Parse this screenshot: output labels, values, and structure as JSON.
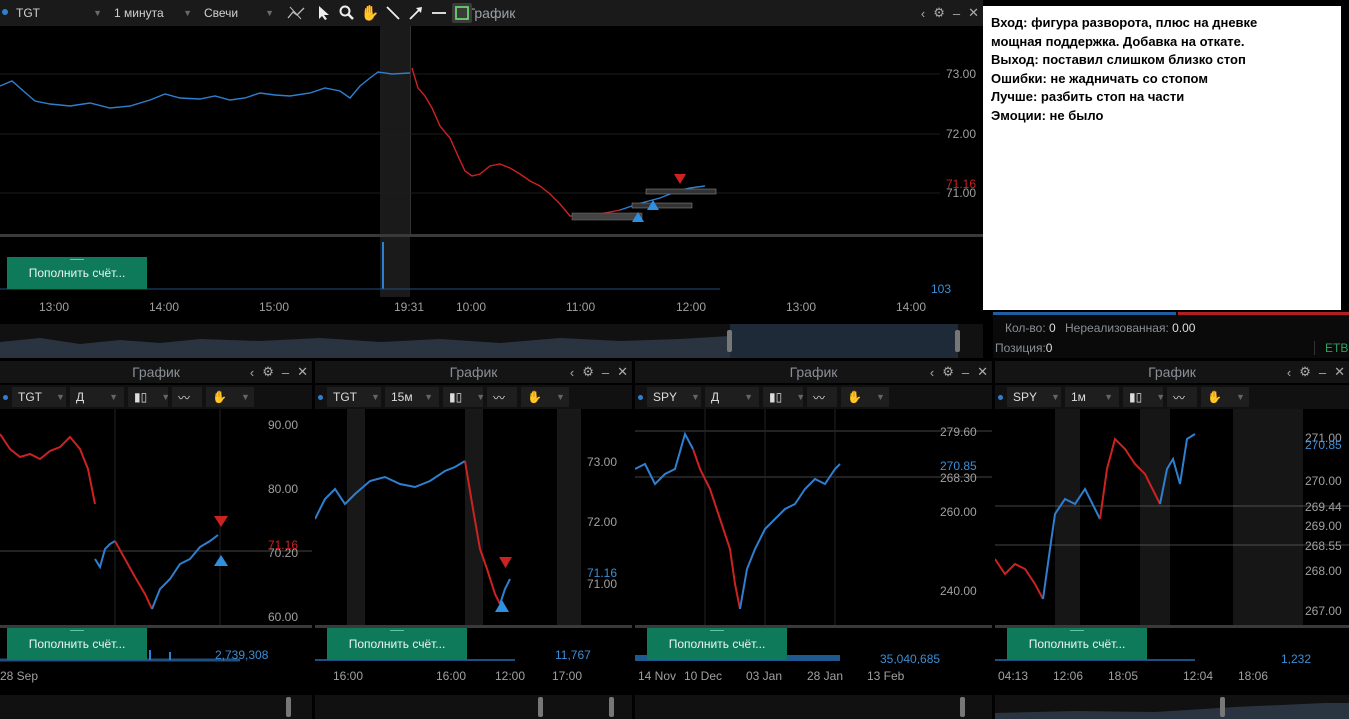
{
  "main": {
    "symbol": "TGT",
    "timeframe": "1 минута",
    "chart_type": "Свечи",
    "title": "График",
    "price_ticks": [
      "73.00",
      "72.00",
      "71.00"
    ],
    "last_price": "71.16",
    "volume_label": "103",
    "time_ticks": [
      "13:00",
      "14:00",
      "15:00",
      "19:31",
      "10:00",
      "11:00",
      "12:00",
      "13:00",
      "14:00"
    ],
    "deposit_label": "Пополнить счёт..."
  },
  "notes": {
    "lines": [
      "Вход: фигура разворота, плюс на дневке",
      "мощная поддержка. Добавка на откате.",
      "Выход: поставил слишком близко стоп",
      "Ошибки: не жадничать со стопом",
      "Лучше: разбить стоп на части",
      "Эмоции: не было"
    ]
  },
  "position": {
    "qty_label": "Кол-во:",
    "qty_value": "0",
    "unrealized_label": "Нереализованная:",
    "unrealized_value": "0.00",
    "position_label": "Позиция:",
    "position_value": "0",
    "etb": "ETB"
  },
  "panels": [
    {
      "title": "График",
      "symbol": "TGT",
      "timeframe": "Д",
      "price_ticks": [
        "90.00",
        "80.00",
        "70.20",
        "60.00"
      ],
      "last_price": "71.16",
      "volume_label": "2,739,308",
      "time_ticks": [
        "28 Sep"
      ],
      "deposit_label": "Пополнить счёт..."
    },
    {
      "title": "График",
      "symbol": "TGT",
      "timeframe": "15м",
      "price_ticks": [
        "73.00",
        "72.00",
        "71.00"
      ],
      "last_price": "71.16",
      "volume_label": "11,767",
      "time_ticks": [
        "16:00",
        "16:00",
        "12:00",
        "17:00"
      ],
      "deposit_label": "Пополнить счёт..."
    },
    {
      "title": "График",
      "symbol": "SPY",
      "timeframe": "Д",
      "price_ticks": [
        "279.60",
        "268.30",
        "260.00",
        "240.00"
      ],
      "last_price": "270.85",
      "volume_label": "35,040,685",
      "time_ticks": [
        "14 Nov",
        "10 Dec",
        "03 Jan",
        "28 Jan",
        "13 Feb"
      ],
      "deposit_label": "Пополнить счёт..."
    },
    {
      "title": "График",
      "symbol": "SPY",
      "timeframe": "1м",
      "price_ticks": [
        "271.00",
        "270.00",
        "269.44",
        "269.00",
        "268.55",
        "268.00",
        "267.00"
      ],
      "last_price": "270.85",
      "volume_label": "1,232",
      "time_ticks": [
        "04:13",
        "12:06",
        "18:05",
        "12:04",
        "18:06"
      ],
      "deposit_label": "Пополнить счёт..."
    }
  ],
  "colors": {
    "up": "#2f7fd0",
    "down": "#cc2222",
    "deposit": "#0f7a5a",
    "background": "#000000"
  }
}
